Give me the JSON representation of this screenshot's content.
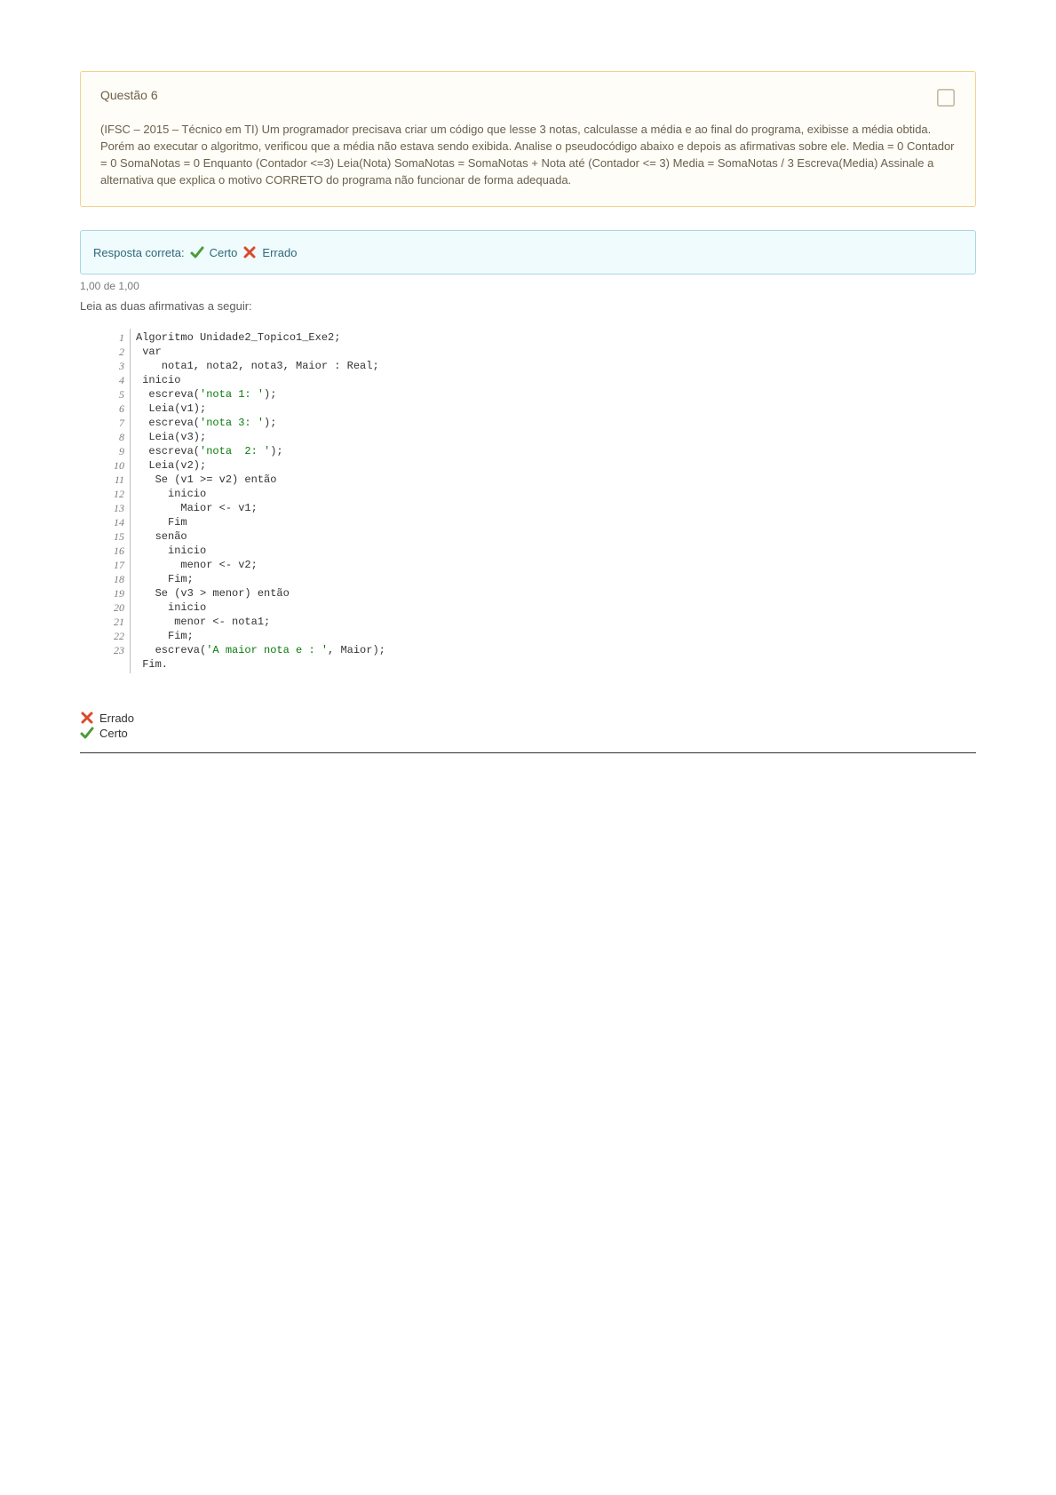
{
  "question": {
    "title": "Questão 6",
    "body": "(IFSC – 2015 – Técnico em TI) Um programador precisava criar um código que lesse 3 notas, calculasse a média e ao final do programa, exibisse a média obtida. Porém ao executar o algoritmo, verificou que a média não estava sendo exibida. Analise o pseudocódigo abaixo e depois as afirmativas sobre ele. Media = 0 Contador = 0 SomaNotas = 0 Enquanto (Contador <=3) Leia(Nota) SomaNotas = SomaNotas + Nota até (Contador <= 3) Media = SomaNotas / 3 Escreva(Media) Assinale a alternativa que explica o motivo CORRETO do programa não funcionar de forma adequada."
  },
  "status": {
    "prefix": "Resposta correta:",
    "correct_label": "Certo",
    "x_label": "Errado",
    "mark_scored": "1,00",
    "mark_of_word": "de",
    "mark_total": "1,00"
  },
  "prompt_line": "Leia as duas afirmativas a seguir:",
  "code": {
    "lines": [
      "Algoritmo Unidade2_Topico1_Exe2;",
      " var",
      "    nota1, nota2, nota3, Maior : Real;",
      " inicio",
      "  escreva('nota 1: ');",
      "  Leia(v1);",
      "  escreva('nota 3: ');",
      "  Leia(v3);",
      "  escreva('nota  2: ');",
      "  Leia(v2);",
      "   Se (v1 >= v2) então",
      "     inicio",
      "       Maior <- v1;",
      "     Fim",
      "   senão",
      "     inicio",
      "       menor <- v2;",
      "     Fim;",
      "   Se (v3 > menor) então",
      "     inicio",
      "      menor <- nota1;",
      "     Fim;",
      "   escreva('A maior nota e : ', Maior);",
      " Fim."
    ]
  },
  "answers": {
    "option_wrong": "Errado",
    "option_right": "Certo"
  }
}
